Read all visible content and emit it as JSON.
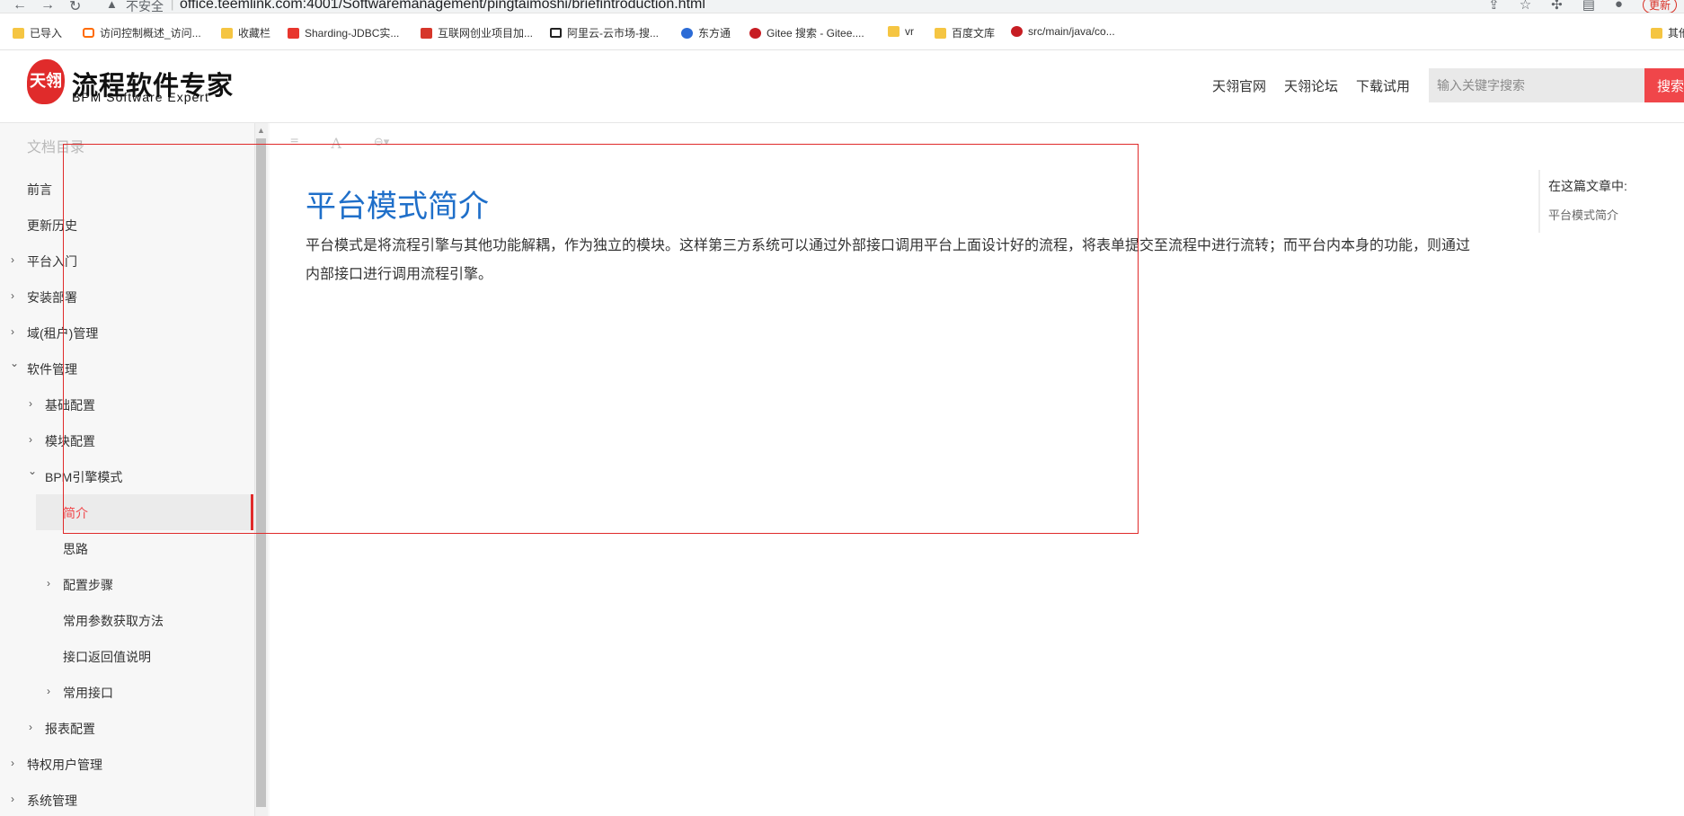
{
  "browser": {
    "insecure_label": "不安全",
    "url": "office.teemlink.com:4001/Softwaremanagement/pingtaimoshi/briefintroduction.html",
    "update_label": "更新",
    "bookmarks": [
      {
        "label": "已导入",
        "icon": "folder-icon"
      },
      {
        "label": "访问控制概述_访问...",
        "icon": "aliyun-icon"
      },
      {
        "label": "收藏栏",
        "icon": "folder-icon"
      },
      {
        "label": "Sharding-JDBC实...",
        "icon": "csdn-icon"
      },
      {
        "label": "互联网创业项目加...",
        "icon": "red-square-icon"
      },
      {
        "label": "阿里云-云市场-搜...",
        "icon": "aliyun-icon"
      },
      {
        "label": "东方通",
        "icon": "baidu-icon"
      },
      {
        "label": "Gitee 搜索 - Gitee....",
        "icon": "gitee-icon"
      },
      {
        "label": "vr",
        "icon": "folder-icon"
      },
      {
        "label": "百度文库",
        "icon": "folder-icon"
      },
      {
        "label": "src/main/java/co...",
        "icon": "gitee-icon"
      },
      {
        "label": "其他",
        "icon": "folder-icon"
      }
    ]
  },
  "header": {
    "logo_mark": "天翎",
    "logo_title": "流程软件专家",
    "logo_subtitle": "BPM Software Expert",
    "nav": [
      "天翎官网",
      "天翎论坛",
      "下载试用"
    ],
    "search_placeholder": "输入关键字搜索",
    "search_button": "搜索"
  },
  "sidebar": {
    "title": "文档目录",
    "items": [
      {
        "label": "前言",
        "level": 0,
        "chevron": ""
      },
      {
        "label": "更新历史",
        "level": 0,
        "chevron": ""
      },
      {
        "label": "平台入门",
        "level": 0,
        "chevron": "›"
      },
      {
        "label": "安装部署",
        "level": 0,
        "chevron": "›"
      },
      {
        "label": "域(租户)管理",
        "level": 0,
        "chevron": "›"
      },
      {
        "label": "软件管理",
        "level": 0,
        "chevron": "⌄"
      },
      {
        "label": "基础配置",
        "level": 1,
        "chevron": "›"
      },
      {
        "label": "模块配置",
        "level": 1,
        "chevron": "›"
      },
      {
        "label": "BPM引擎模式",
        "level": 1,
        "chevron": "⌄"
      },
      {
        "label": "简介",
        "level": 2,
        "chevron": "",
        "active": true
      },
      {
        "label": "思路",
        "level": 2,
        "chevron": ""
      },
      {
        "label": "配置步骤",
        "level": 2,
        "chevron": "›"
      },
      {
        "label": "常用参数获取方法",
        "level": 2,
        "chevron": ""
      },
      {
        "label": "接口返回值说明",
        "level": 2,
        "chevron": ""
      },
      {
        "label": "常用接口",
        "level": 2,
        "chevron": "›"
      },
      {
        "label": "报表配置",
        "level": 1,
        "chevron": "›"
      },
      {
        "label": "特权用户管理",
        "level": 0,
        "chevron": "›"
      },
      {
        "label": "系统管理",
        "level": 0,
        "chevron": "›"
      }
    ]
  },
  "toolbar": {
    "menu_icon": "≡",
    "font_icon": "A",
    "theme_icon": "⊖▾"
  },
  "article": {
    "title": "平台模式简介",
    "body": "平台模式是将流程引擎与其他功能解耦，作为独立的模块。这样第三方系统可以通过外部接口调用平台上面设计好的流程，将表单提交至流程中进行流转；而平台内本身的功能，则通过内部接口进行调用流程引擎。"
  },
  "toc": {
    "title": "在这篇文章中:",
    "links": [
      "平台模式简介"
    ]
  },
  "colors": {
    "accent": "#f0464a",
    "title_blue": "#1f6fc9",
    "sidebar_bg": "#f7f7f7"
  }
}
